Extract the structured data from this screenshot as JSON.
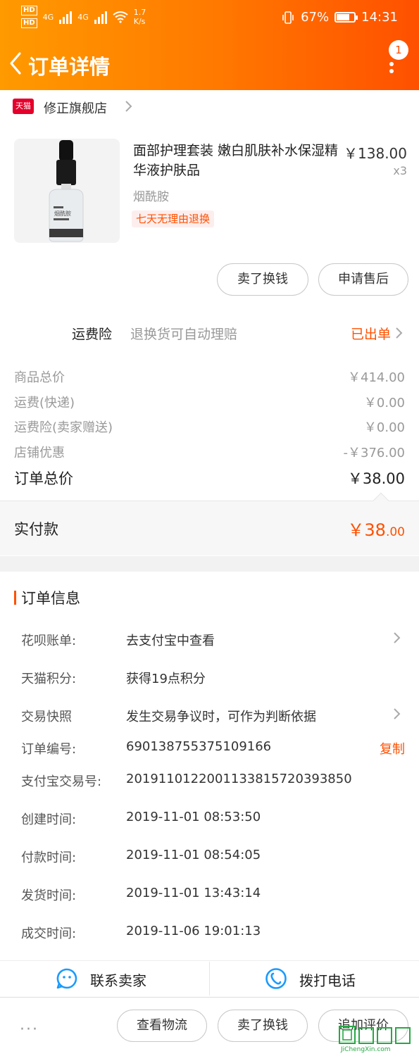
{
  "status_bar": {
    "hd1": "HD",
    "hd2": "HD",
    "net1": "4G",
    "net2": "4G",
    "speed": "1.7",
    "speed_unit": "K/s",
    "battery_pct": "67%",
    "battery_level": 0.67,
    "time": "14:31"
  },
  "nav": {
    "title": "订单详情",
    "badge": "1"
  },
  "shop": {
    "logo_text": "天猫",
    "name": "修正旗舰店"
  },
  "product": {
    "title": "面部护理套装 嫩白肌肤补水保湿精华液护肤品",
    "price": "￥138.00",
    "quantity": "x3",
    "spec": "烟酰胺",
    "tag": "七天无理由退换",
    "label_text": "烟酰胺"
  },
  "actions": {
    "sell_exchange": "卖了换钱",
    "after_sale": "申请售后"
  },
  "insurance": {
    "label": "运费险",
    "desc": "退换货可自动理赔",
    "status": "已出单"
  },
  "fees": [
    {
      "label": "商品总价",
      "value": "￥414.00"
    },
    {
      "label": "运费(快递)",
      "value": "￥0.00"
    },
    {
      "label": "运费险(卖家赠送)",
      "value": "￥0.00"
    },
    {
      "label": "店铺优惠",
      "value": "-￥376.00"
    }
  ],
  "total": {
    "label": "订单总价",
    "value": "￥38.00"
  },
  "paid": {
    "label": "实付款",
    "currency_int": "￥38",
    "decimals": ".00"
  },
  "order_info": {
    "title": "订单信息",
    "rows": [
      {
        "label": "花呗账单:",
        "value": "去支付宝中查看"
      },
      {
        "label": "天猫积分:",
        "value": "获得19点积分"
      },
      {
        "label": "交易快照",
        "value": "发生交易争议时，可作为判断依据"
      },
      {
        "label": "订单编号:",
        "value": "690138755375109166"
      },
      {
        "label": "支付宝交易号:",
        "value": "2019110122001133815720393850"
      },
      {
        "label": "创建时间:",
        "value": "2019-11-01 08:53:50"
      },
      {
        "label": "付款时间:",
        "value": "2019-11-01 08:54:05"
      },
      {
        "label": "发货时间:",
        "value": "2019-11-01 13:43:14"
      },
      {
        "label": "成交时间:",
        "value": "2019-11-06 19:01:13"
      }
    ],
    "copy_label": "复制"
  },
  "contact": {
    "seller": "联系卖家",
    "call": "拨打电话"
  },
  "bottom_bar": {
    "more": "···",
    "logistics": "查看物流",
    "sell_exchange": "卖了换钱",
    "add_review": "追加评价",
    "watermark": "JiChengXin.com"
  },
  "colors": {
    "accent": "#ff5000",
    "header_start": "#ff9a00",
    "header_end": "#ff5000"
  }
}
